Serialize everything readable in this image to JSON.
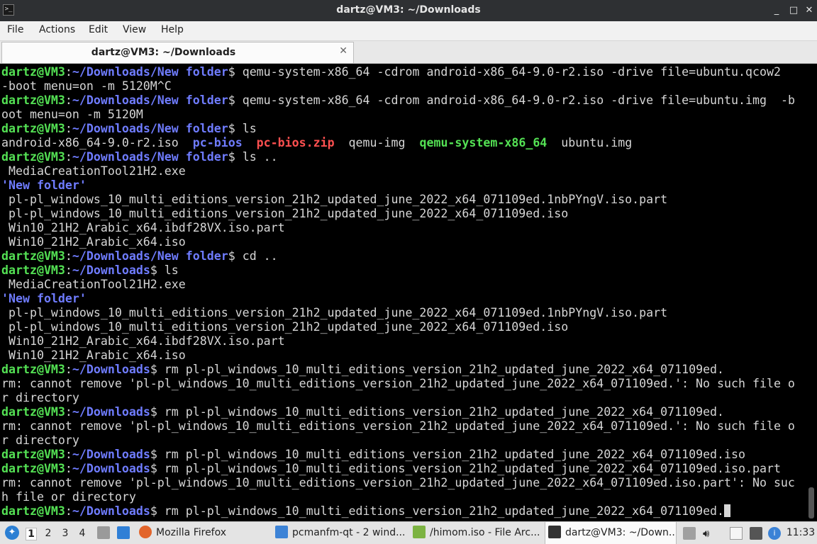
{
  "window": {
    "title": "dartz@VM3: ~/Downloads",
    "controls": {
      "minimize": "_",
      "maximize": "□",
      "close": "✕"
    }
  },
  "menu": [
    "File",
    "Actions",
    "Edit",
    "View",
    "Help"
  ],
  "tab": {
    "label": "dartz@VM3: ~/Downloads",
    "close": "✕"
  },
  "terminal": {
    "lines": [
      [
        [
          "dartz@VM3",
          "user"
        ],
        [
          ":",
          "plain"
        ],
        [
          "~/Downloads/New folder",
          "path"
        ],
        [
          "$ qemu-system-x86_64 -cdrom android-x86_64-9.0-r2.iso -drive file=ubuntu.qcow2",
          "plain"
        ]
      ],
      [
        [
          "-boot menu=on -m 5120M^C",
          "plain"
        ]
      ],
      [
        [
          "dartz@VM3",
          "user"
        ],
        [
          ":",
          "plain"
        ],
        [
          "~/Downloads/New folder",
          "path"
        ],
        [
          "$ qemu-system-x86_64 -cdrom android-x86_64-9.0-r2.iso -drive file=ubuntu.img  -b",
          "plain"
        ]
      ],
      [
        [
          "oot menu=on -m 5120M",
          "plain"
        ]
      ],
      [
        [
          "dartz@VM3",
          "user"
        ],
        [
          ":",
          "plain"
        ],
        [
          "~/Downloads/New folder",
          "path"
        ],
        [
          "$ ls",
          "plain"
        ]
      ],
      [
        [
          "android-x86_64-9.0-r2.iso  ",
          "plain"
        ],
        [
          "pc-bios",
          "dir"
        ],
        [
          "  ",
          "plain"
        ],
        [
          "pc-bios.zip",
          "archive"
        ],
        [
          "  qemu-img  ",
          "plain"
        ],
        [
          "qemu-system-x86_64",
          "exec"
        ],
        [
          "  ubuntu.img",
          "plain"
        ]
      ],
      [
        [
          "dartz@VM3",
          "user"
        ],
        [
          ":",
          "plain"
        ],
        [
          "~/Downloads/New folder",
          "path"
        ],
        [
          "$ ls ..",
          "plain"
        ]
      ],
      [
        [
          " MediaCreationTool21H2.exe",
          "plain"
        ]
      ],
      [
        [
          "'New folder'",
          "dir"
        ]
      ],
      [
        [
          " pl-pl_windows_10_multi_editions_version_21h2_updated_june_2022_x64_071109ed.1nbPYngV.iso.part",
          "plain"
        ]
      ],
      [
        [
          " pl-pl_windows_10_multi_editions_version_21h2_updated_june_2022_x64_071109ed.iso",
          "plain"
        ]
      ],
      [
        [
          " Win10_21H2_Arabic_x64.ibdf28VX.iso.part",
          "plain"
        ]
      ],
      [
        [
          " Win10_21H2_Arabic_x64.iso",
          "plain"
        ]
      ],
      [
        [
          "dartz@VM3",
          "user"
        ],
        [
          ":",
          "plain"
        ],
        [
          "~/Downloads/New folder",
          "path"
        ],
        [
          "$ cd ..",
          "plain"
        ]
      ],
      [
        [
          "dartz@VM3",
          "user"
        ],
        [
          ":",
          "plain"
        ],
        [
          "~/Downloads",
          "path"
        ],
        [
          "$ ls",
          "plain"
        ]
      ],
      [
        [
          " MediaCreationTool21H2.exe",
          "plain"
        ]
      ],
      [
        [
          "'New folder'",
          "dir"
        ]
      ],
      [
        [
          " pl-pl_windows_10_multi_editions_version_21h2_updated_june_2022_x64_071109ed.1nbPYngV.iso.part",
          "plain"
        ]
      ],
      [
        [
          " pl-pl_windows_10_multi_editions_version_21h2_updated_june_2022_x64_071109ed.iso",
          "plain"
        ]
      ],
      [
        [
          " Win10_21H2_Arabic_x64.ibdf28VX.iso.part",
          "plain"
        ]
      ],
      [
        [
          " Win10_21H2_Arabic_x64.iso",
          "plain"
        ]
      ],
      [
        [
          "dartz@VM3",
          "user"
        ],
        [
          ":",
          "plain"
        ],
        [
          "~/Downloads",
          "path"
        ],
        [
          "$ rm pl-pl_windows_10_multi_editions_version_21h2_updated_june_2022_x64_071109ed.",
          "plain"
        ]
      ],
      [
        [
          "rm: cannot remove 'pl-pl_windows_10_multi_editions_version_21h2_updated_june_2022_x64_071109ed.': No such file o",
          "plain"
        ]
      ],
      [
        [
          "r directory",
          "plain"
        ]
      ],
      [
        [
          "dartz@VM3",
          "user"
        ],
        [
          ":",
          "plain"
        ],
        [
          "~/Downloads",
          "path"
        ],
        [
          "$ rm pl-pl_windows_10_multi_editions_version_21h2_updated_june_2022_x64_071109ed.",
          "plain"
        ]
      ],
      [
        [
          "rm: cannot remove 'pl-pl_windows_10_multi_editions_version_21h2_updated_june_2022_x64_071109ed.': No such file o",
          "plain"
        ]
      ],
      [
        [
          "r directory",
          "plain"
        ]
      ],
      [
        [
          "dartz@VM3",
          "user"
        ],
        [
          ":",
          "plain"
        ],
        [
          "~/Downloads",
          "path"
        ],
        [
          "$ rm pl-pl_windows_10_multi_editions_version_21h2_updated_june_2022_x64_071109ed.iso",
          "plain"
        ]
      ],
      [
        [
          "dartz@VM3",
          "user"
        ],
        [
          ":",
          "plain"
        ],
        [
          "~/Downloads",
          "path"
        ],
        [
          "$ rm pl-pl_windows_10_multi_editions_version_21h2_updated_june_2022_x64_071109ed.iso.part",
          "plain"
        ]
      ],
      [
        [
          "rm: cannot remove 'pl-pl_windows_10_multi_editions_version_21h2_updated_june_2022_x64_071109ed.iso.part': No suc",
          "plain"
        ]
      ],
      [
        [
          "h file or directory",
          "plain"
        ]
      ],
      [
        [
          "dartz@VM3",
          "user"
        ],
        [
          ":",
          "plain"
        ],
        [
          "~/Downloads",
          "path"
        ],
        [
          "$ rm pl-pl_windows_10_multi_editions_version_21h2_updated_june_2022_x64_071109ed.",
          "plain"
        ]
      ]
    ]
  },
  "taskbar": {
    "workspaces": [
      "1",
      "2",
      "3",
      "4"
    ],
    "active_workspace": "1",
    "tasks": [
      {
        "label": "Mozilla Firefox",
        "icon": "firefox-icon"
      },
      {
        "label": "pcmanfm-qt - 2 wind...",
        "icon": "folder-icon"
      },
      {
        "label": "/himom.iso - File Arc...",
        "icon": "archive-icon"
      },
      {
        "label": "dartz@VM3: ~/Down...",
        "icon": "terminal-icon"
      }
    ],
    "clock": "11:33"
  },
  "colors": {
    "prompt_user": "#54e154",
    "prompt_path": "#6f7cff",
    "archive": "#ff5050",
    "terminal_bg": "#000000",
    "terminal_fg": "#d6d6d6"
  }
}
